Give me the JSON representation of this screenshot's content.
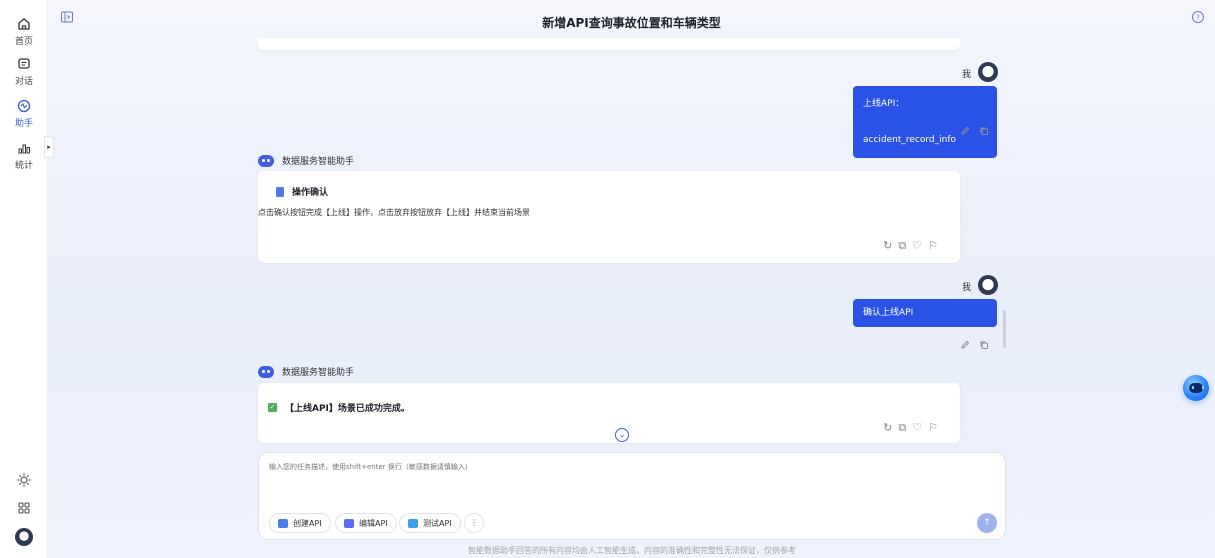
{
  "header": {
    "title": "新增API查询事故位置和车辆类型"
  },
  "sidebar": {
    "items": [
      {
        "label": "首页",
        "icon": "home-icon"
      },
      {
        "label": "对话",
        "icon": "chat-icon"
      },
      {
        "label": "助手",
        "icon": "assistant-icon",
        "active": true
      },
      {
        "label": "统计",
        "icon": "stats-icon"
      }
    ],
    "bottom_icons": [
      "theme-sun-icon",
      "apps-grid-icon",
      "user-avatar"
    ]
  },
  "chat": {
    "me_label": "我",
    "bot_name": "数据服务智能助手",
    "messages": [
      {
        "role": "user",
        "text": "上线API：accident_record_info"
      },
      {
        "role": "bot",
        "title": "操作确认",
        "text": "点击确认按钮完成【上线】操作，点击放弃按钮放弃【上线】并结束当前场景"
      },
      {
        "role": "user",
        "text": "确认上线API"
      },
      {
        "role": "bot",
        "text": "【上线API】场景已成功完成。"
      }
    ]
  },
  "input": {
    "placeholder": "输入您的任务描述，使用shift+enter 换行（敏感数据请慎输入）",
    "chips": [
      {
        "label": "创建API",
        "color": "#4a7be8"
      },
      {
        "label": "编辑API",
        "color": "#5b6cf0"
      },
      {
        "label": "测试API",
        "color": "#39a0e8"
      }
    ]
  },
  "disclaimer": "智能数据助手回答的所有内容均由人工智能生成，内容的准确性和完整性无法保证，仅供参考"
}
